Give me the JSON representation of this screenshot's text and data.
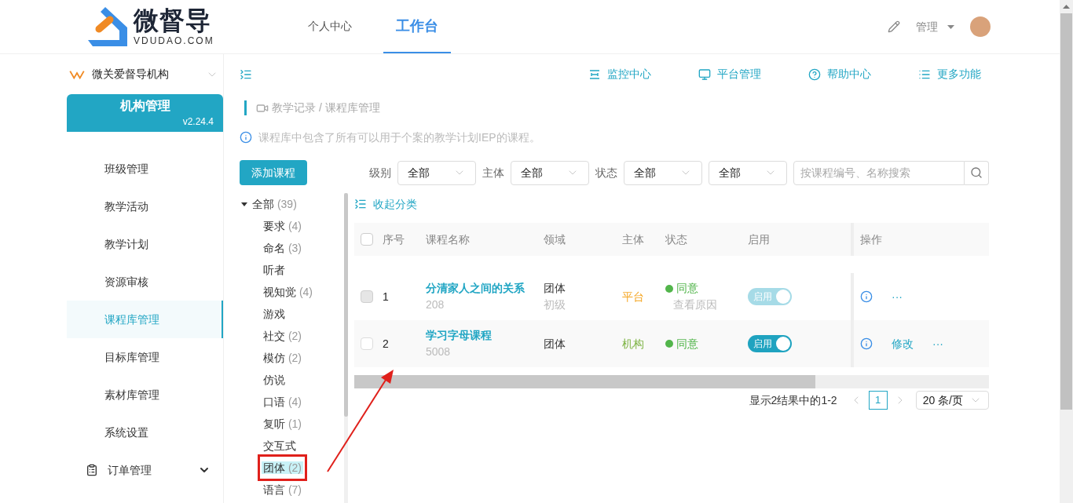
{
  "header": {
    "logo": {
      "name": "微督导",
      "sub": "VDUDAO.COM"
    },
    "nav": [
      {
        "label": "个人中心",
        "selected": false
      },
      {
        "label": "工作台",
        "selected": true
      }
    ],
    "user": {
      "name": "管理"
    }
  },
  "sidebar": {
    "org": {
      "name": "微关爱督导机构"
    },
    "banner": {
      "title": "机构管理",
      "version": "v2.24.4"
    },
    "items": [
      {
        "label": "班级管理",
        "selected": false
      },
      {
        "label": "教学活动",
        "selected": false
      },
      {
        "label": "教学计划",
        "selected": false
      },
      {
        "label": "资源审核",
        "selected": false
      },
      {
        "label": "课程库管理",
        "selected": true
      },
      {
        "label": "目标库管理",
        "selected": false
      },
      {
        "label": "素材库管理",
        "selected": false
      },
      {
        "label": "系统设置",
        "selected": false
      }
    ],
    "group": {
      "label": "订单管理",
      "expanded": false
    }
  },
  "toolbar": [
    {
      "kind": "monitor",
      "label": "监控中心"
    },
    {
      "kind": "screen",
      "label": "平台管理"
    },
    {
      "kind": "help",
      "label": "帮助中心"
    },
    {
      "kind": "list",
      "label": "更多功能"
    }
  ],
  "breadcrumb": "教学记录 / 课程库管理",
  "notice": "课程库中包含了所有可以用于个案的教学计划IEP的课程。",
  "add_button": "添加课程",
  "filters": [
    {
      "label": "级别",
      "value": "全部"
    },
    {
      "label": "主体",
      "value": "全部"
    },
    {
      "label": "状态",
      "value": "全部"
    },
    {
      "value": "全部"
    }
  ],
  "search": {
    "placeholder": "按课程编号、名称搜索"
  },
  "tree": {
    "label": "全部",
    "count": "(39)",
    "expanded": true,
    "children": [
      {
        "label": "要求",
        "count": "(4)",
        "selected": false
      },
      {
        "label": "命名",
        "count": "(3)",
        "selected": false
      },
      {
        "label": "听者",
        "selected": false
      },
      {
        "label": "视知觉",
        "count": "(4)",
        "selected": false
      },
      {
        "label": "游戏",
        "selected": false
      },
      {
        "label": "社交",
        "count": "(2)",
        "selected": false
      },
      {
        "label": "模仿",
        "count": "(2)",
        "selected": false
      },
      {
        "label": "仿说",
        "selected": false
      },
      {
        "label": "口语",
        "count": "(4)",
        "selected": false
      },
      {
        "label": "复听",
        "count": "(1)",
        "selected": false
      },
      {
        "label": "交互式",
        "selected": false
      },
      {
        "label": "团体",
        "count": "(2)",
        "selected": true
      },
      {
        "label": "语言",
        "count": "(7)",
        "selected": false
      }
    ]
  },
  "collapse_link": "收起分类",
  "table": {
    "select_all": {
      "checked": false
    },
    "columns": [
      "序号",
      "课程名称",
      "领域",
      "主体",
      "状态",
      "启用",
      "操作"
    ],
    "rows": [
      {
        "disabled": true,
        "no": "1",
        "name": "分清家人之间的关系",
        "code": "208",
        "domain": "团体",
        "level": "初级",
        "owner": {
          "label": "平台",
          "color": "#f5a623"
        },
        "status": {
          "label": "同意",
          "color": "#52b54b"
        },
        "reason": "查看原因",
        "toggle": {
          "label": "启用",
          "on": true,
          "disabled": true
        },
        "actions": [
          "···"
        ]
      },
      {
        "disabled": false,
        "no": "2",
        "name": "学习字母课程",
        "code": "5008",
        "domain": "团体",
        "owner": {
          "label": "机构",
          "color": "#7cb342"
        },
        "status": {
          "label": "同意",
          "color": "#52b54b"
        },
        "toggle": {
          "label": "启用",
          "on": true,
          "disabled": false
        },
        "actions": [
          "修改",
          "···"
        ]
      }
    ]
  },
  "pagination": {
    "summary": "显示2结果中的1-2",
    "pages": [
      {
        "label": "1",
        "selected": true
      }
    ],
    "page_size": "20 条/页"
  }
}
